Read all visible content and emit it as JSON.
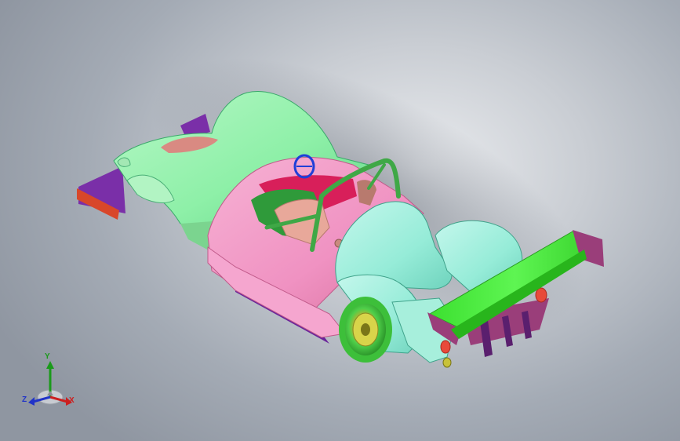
{
  "viewport": {
    "background_center": "#e9ebee",
    "background_edge": "#8f96a1"
  },
  "model": {
    "colors": {
      "body_green": "#8ef0a8",
      "body_cyan": "#96ecd8",
      "cockpit_pink": "#f092c2",
      "wing_green": "#46f039",
      "splitter_purple": "#7a2fa8",
      "endplate_orange": "#d8472a",
      "rollbar_green": "#3fa846",
      "seat_tan": "#e8a89a",
      "floor_red": "#d81f5a",
      "wheel_green": "#4fcf4a",
      "wheel_gold": "#c8c23a",
      "light_red": "#e84a3a"
    }
  },
  "triad": {
    "y_label": "Y",
    "z_label": "Z",
    "x_label": "X",
    "y_color": "#1a9a1a",
    "z_color": "#2033c8",
    "x_color": "#cc1f1f"
  }
}
